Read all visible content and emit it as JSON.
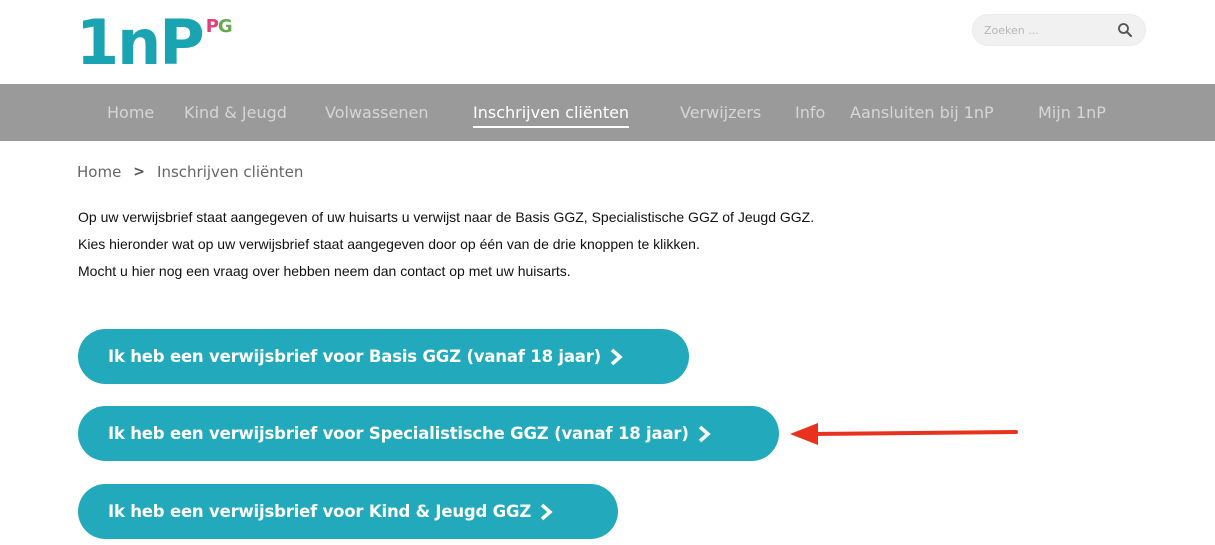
{
  "logo": {
    "main": "1nP",
    "sup_p": "P",
    "sup_g": "G"
  },
  "search": {
    "placeholder": "Zoeken ..."
  },
  "nav": {
    "items": [
      {
        "label": "Home"
      },
      {
        "label": "Kind & Jeugd"
      },
      {
        "label": "Volwassenen"
      },
      {
        "label": "Inschrijven cliënten"
      },
      {
        "label": "Verwijzers"
      },
      {
        "label": "Info"
      },
      {
        "label": "Aansluiten bij 1nP"
      },
      {
        "label": "Mijn 1nP"
      }
    ],
    "active": "Inschrijven cliënten"
  },
  "breadcrumb": {
    "home": "Home",
    "separator": ">",
    "current": "Inschrijven cliënten"
  },
  "intro": {
    "lines": [
      "Op uw verwijsbrief staat aangegeven of uw huisarts u verwijst naar de Basis GGZ, Specialistische GGZ of Jeugd GGZ.",
      "Kies hieronder wat op uw verwijsbrief staat aangegeven door op één van de drie knoppen te klikken.",
      "Mocht u hier nog een vraag over hebben neem dan contact op met uw huisarts."
    ]
  },
  "buttons": [
    {
      "label": "Ik heb een verwijsbrief voor Basis GGZ (vanaf 18 jaar)"
    },
    {
      "label": "Ik heb een verwijsbrief voor Specialistische GGZ (vanaf 18 jaar)"
    },
    {
      "label": "Ik heb een verwijsbrief voor Kind & Jeugd GGZ"
    }
  ],
  "colors": {
    "brand_teal": "#1aa3b1",
    "button": "#22a9bc",
    "nav_bg": "#9a9a9a",
    "annotation_arrow": "#e8321e"
  },
  "icons": [
    "search-icon",
    "chevron-right-icon",
    "annotation-arrow"
  ]
}
